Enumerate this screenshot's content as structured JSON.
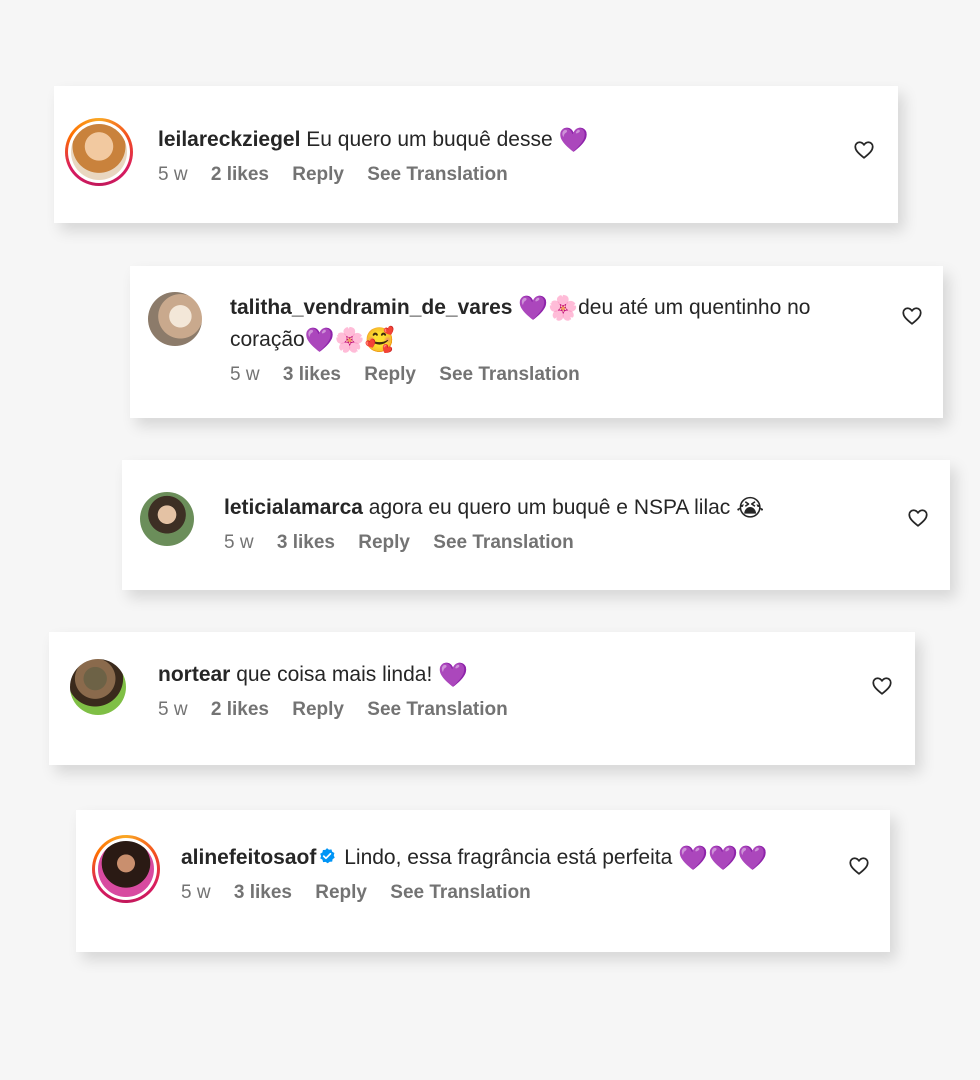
{
  "comments": [
    {
      "username": "leilareckziegel",
      "text": "Eu quero um buquê desse",
      "emoji": "💜",
      "time": "5 w",
      "likes": "2 likes",
      "reply": "Reply",
      "translate": "See Translation",
      "has_story_ring": true
    },
    {
      "username": "talitha_vendramin_de_vares",
      "text_pre": "💜🌸",
      "text": "deu até um quentinho no coração",
      "emoji": "💜🌸🥰",
      "time": "5 w",
      "likes": "3 likes",
      "reply": "Reply",
      "translate": "See Translation",
      "has_story_ring": false
    },
    {
      "username": "leticialamarca",
      "text": "agora eu quero um buquê e NSPA lilac",
      "emoji": "😭",
      "time": "5 w",
      "likes": "3 likes",
      "reply": "Reply",
      "translate": "See Translation",
      "has_story_ring": false
    },
    {
      "username": "nortear",
      "text": "que coisa mais linda!",
      "emoji": "💜",
      "time": "5 w",
      "likes": "2 likes",
      "reply": "Reply",
      "translate": "See Translation",
      "has_story_ring": false
    },
    {
      "username": "alinefeitosaof",
      "verified": true,
      "text": "Lindo, essa fragrância está perfeita",
      "emoji": "💜💜💜",
      "time": "5 w",
      "likes": "3 likes",
      "reply": "Reply",
      "translate": "See Translation",
      "has_story_ring": true
    }
  ],
  "icons": {
    "like": "heart-outline-icon",
    "verified": "verified-badge-icon"
  },
  "colors": {
    "text": "#262626",
    "meta": "#737373",
    "verified": "#0095f6",
    "background": "#f6f6f6"
  }
}
